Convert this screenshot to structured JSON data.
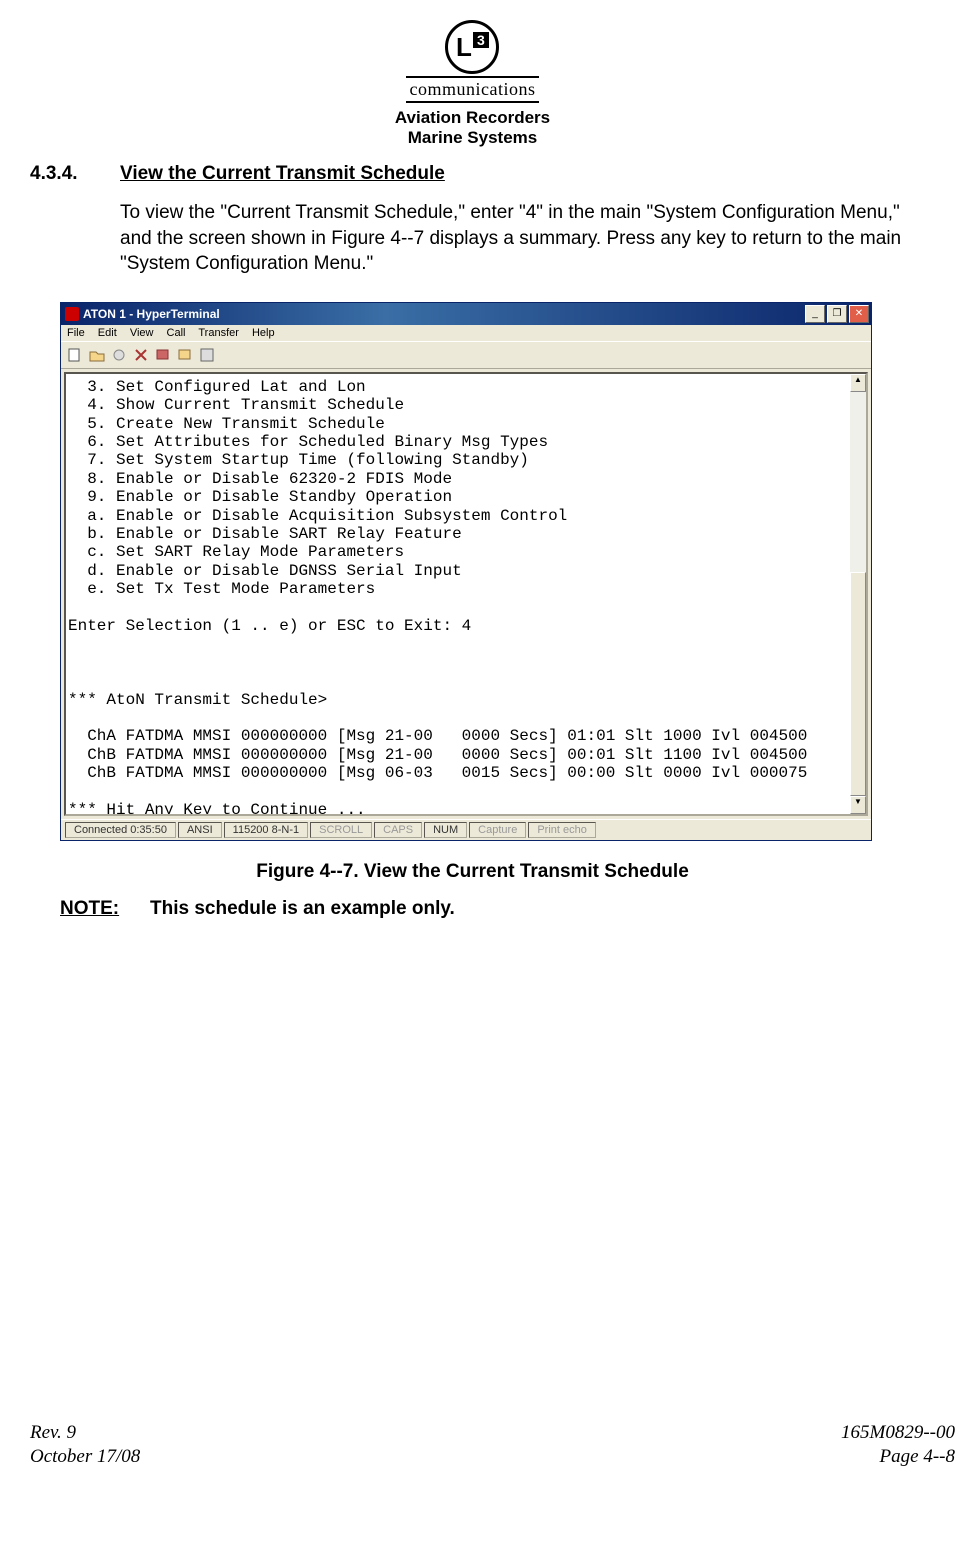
{
  "header": {
    "logo_letter": "L",
    "logo_num": "3",
    "company": "communications",
    "line1": "Aviation Recorders",
    "line2": "Marine Systems"
  },
  "section": {
    "number": "4.3.4.",
    "title": "View the Current Transmit Schedule"
  },
  "paragraph": "To view the \"Current Transmit Schedule,\" enter \"4\" in the main \"System Configuration Menu,\" and the screen shown in Figure 4--7 displays a summary. Press any key to return to the main \"System Configuration Menu.\"",
  "hyperterminal": {
    "title": "ATON 1 - HyperTerminal",
    "menu": {
      "file": "File",
      "edit": "Edit",
      "view": "View",
      "call": "Call",
      "transfer": "Transfer",
      "help": "Help"
    },
    "content": "  3. Set Configured Lat and Lon\n  4. Show Current Transmit Schedule\n  5. Create New Transmit Schedule\n  6. Set Attributes for Scheduled Binary Msg Types\n  7. Set System Startup Time (following Standby)\n  8. Enable or Disable 62320-2 FDIS Mode\n  9. Enable or Disable Standby Operation\n  a. Enable or Disable Acquisition Subsystem Control\n  b. Enable or Disable SART Relay Feature\n  c. Set SART Relay Mode Parameters\n  d. Enable or Disable DGNSS Serial Input\n  e. Set Tx Test Mode Parameters\n\nEnter Selection (1 .. e) or ESC to Exit: 4\n\n\n\n*** AtoN Transmit Schedule>\n\n  ChA FATDMA MMSI 000000000 [Msg 21-00   0000 Secs] 01:01 Slt 1000 Ivl 004500\n  ChB FATDMA MMSI 000000000 [Msg 21-00   0000 Secs] 00:01 Slt 1100 Ivl 004500\n  ChB FATDMA MMSI 000000000 [Msg 06-03   0015 Secs] 00:00 Slt 0000 Ivl 000075\n\n*** Hit Any Key to Continue ...",
    "status": {
      "connected": "Connected 0:35:50",
      "encoding": "ANSI",
      "baud": "115200 8-N-1",
      "scroll": "SCROLL",
      "caps": "CAPS",
      "num": "NUM",
      "capture": "Capture",
      "printecho": "Print echo"
    }
  },
  "figure_caption": "Figure 4--7.  View the Current Transmit Schedule",
  "note": {
    "label": "NOTE:",
    "text": "This schedule is an example only."
  },
  "footer": {
    "rev": "Rev. 9",
    "date": "October 17/08",
    "docnum": "165M0829--00",
    "page": "Page 4--8"
  }
}
